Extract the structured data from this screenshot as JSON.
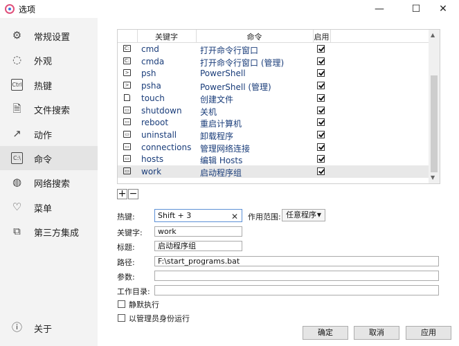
{
  "window": {
    "title": "选项",
    "minimize": "—",
    "maximize": "☐",
    "close": "✕"
  },
  "sidebar": {
    "items": [
      {
        "label": "常规设置",
        "icon": "gear-icon",
        "glyph": "⚙"
      },
      {
        "label": "外观",
        "icon": "palette-icon",
        "glyph": "◌"
      },
      {
        "label": "热键",
        "icon": "ctrl-key-icon",
        "glyph": "Ctrl"
      },
      {
        "label": "文件搜索",
        "icon": "file-search-icon",
        "glyph": "🗎"
      },
      {
        "label": "动作",
        "icon": "action-arrow-icon",
        "glyph": "↗"
      },
      {
        "label": "命令",
        "icon": "terminal-icon",
        "glyph": "C:\\"
      },
      {
        "label": "网络搜索",
        "icon": "globe-icon",
        "glyph": "◍"
      },
      {
        "label": "菜单",
        "icon": "menu-heart-icon",
        "glyph": "♡"
      },
      {
        "label": "第三方集成",
        "icon": "integration-icon",
        "glyph": "⧉"
      }
    ],
    "about": {
      "label": "关于",
      "icon": "info-icon",
      "glyph": "ⓘ"
    },
    "active_index": 5
  },
  "table": {
    "columns": [
      "关键字",
      "命令",
      "启用"
    ],
    "rows": [
      {
        "icon": "terminal",
        "keyword": "cmd",
        "command": "打开命令行窗口",
        "enabled": true
      },
      {
        "icon": "terminal",
        "keyword": "cmda",
        "command": "打开命令行窗口 (管理)",
        "enabled": true
      },
      {
        "icon": "powershell",
        "keyword": "psh",
        "command": "PowerShell",
        "enabled": true
      },
      {
        "icon": "powershell",
        "keyword": "psha",
        "command": "PowerShell (管理)",
        "enabled": true
      },
      {
        "icon": "file",
        "keyword": "touch",
        "command": "创建文件",
        "enabled": true
      },
      {
        "icon": "shortcut",
        "keyword": "shutdown",
        "command": "关机",
        "enabled": true
      },
      {
        "icon": "shortcut",
        "keyword": "reboot",
        "command": "重启计算机",
        "enabled": true
      },
      {
        "icon": "shortcut",
        "keyword": "uninstall",
        "command": "卸载程序",
        "enabled": true
      },
      {
        "icon": "shortcut",
        "keyword": "connections",
        "command": "管理网络连接",
        "enabled": true
      },
      {
        "icon": "shortcut",
        "keyword": "hosts",
        "command": "编辑 Hosts",
        "enabled": true
      },
      {
        "icon": "shortcut",
        "keyword": "work",
        "command": "启动程序组",
        "enabled": true
      }
    ],
    "selected_index": 10
  },
  "table_buttons": {
    "add": "+",
    "remove": "−"
  },
  "form": {
    "hotkey_label": "热键:",
    "hotkey_value": "Shift + 3",
    "scope_label": "作用范围:",
    "scope_value": "任意程序",
    "keyword_label": "关键字:",
    "keyword_value": "work",
    "title_label": "标题:",
    "title_value": "启动程序组",
    "path_label": "路径:",
    "path_value": "F:\\start_programs.bat",
    "params_label": "参数:",
    "params_value": "",
    "workdir_label": "工作目录:",
    "workdir_value": "",
    "silent_label": "静默执行",
    "silent_checked": false,
    "admin_label": "以管理员身份运行",
    "admin_checked": false
  },
  "buttons": {
    "ok": "确定",
    "cancel": "取消",
    "apply": "应用"
  }
}
